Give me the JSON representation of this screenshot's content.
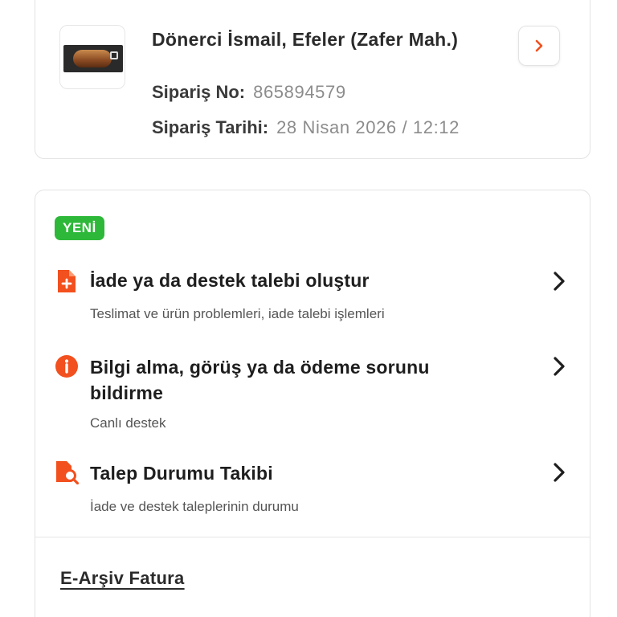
{
  "order": {
    "store_name": "Dönerci İsmail, Efeler (Zafer Mah.)",
    "order_no_label": "Sipariş No:",
    "order_no_value": "865894579",
    "order_date_label": "Sipariş Tarihi:",
    "order_date_value": "28 Nisan 2026 / 12:12",
    "thumbnail_icon": "food-thumbnail",
    "go_icon": "chevron-right-icon"
  },
  "support": {
    "badge": "YENİ",
    "items": [
      {
        "title": "İade ya da destek talebi oluştur",
        "subtitle": "Teslimat ve ürün problemleri, iade talebi işlemleri",
        "icon": "document-plus-icon"
      },
      {
        "title": "Bilgi alma, görüş ya da ödeme sorunu bildirme",
        "subtitle": "Canlı destek",
        "icon": "info-icon"
      },
      {
        "title": "Talep Durumu Takibi",
        "subtitle": "İade ve destek taleplerinin durumu",
        "icon": "document-search-icon"
      }
    ],
    "invoice_link": "E-Arşiv Fatura"
  },
  "colors": {
    "accent": "#f2501e",
    "badge_green": "#2db839",
    "border": "#e3e3e3"
  }
}
